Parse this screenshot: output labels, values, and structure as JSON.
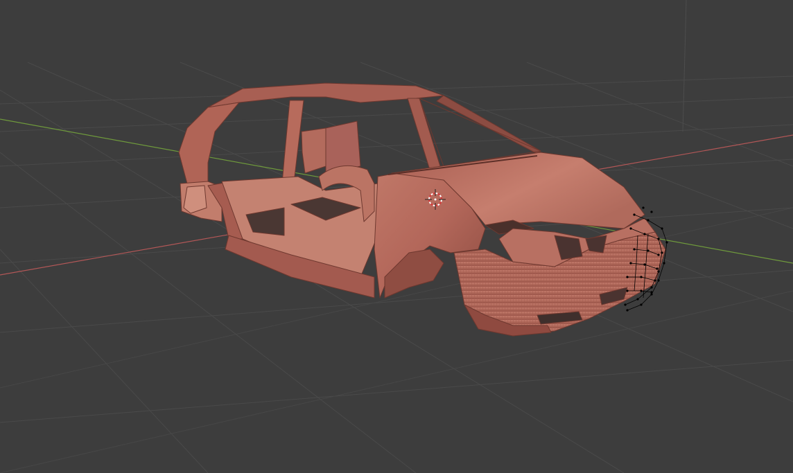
{
  "viewport": {
    "mode": "edit-mode",
    "shading": "solid",
    "background_color": "#3d3d3d",
    "grid_color": "#4a4a4a",
    "x_axis_color": "#b35757",
    "y_axis_color": "#6f9a3c",
    "mesh_color": "#b56a5b",
    "mesh_shadow_color": "#7a3f35",
    "vertex_color": "#000000"
  },
  "scene": {
    "object": "car-body-mesh",
    "cursor_icon": "3d-cursor-icon",
    "selected_region": "front-grille-vertices"
  }
}
